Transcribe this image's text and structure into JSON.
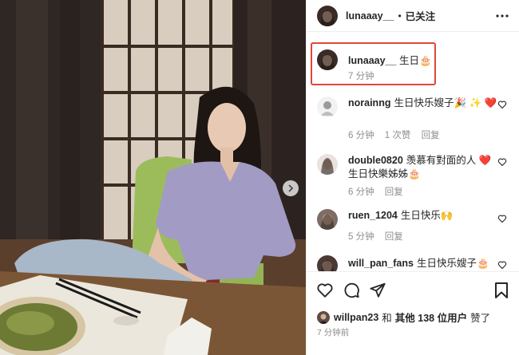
{
  "post": {
    "username": "lunaaay__",
    "separator": "•",
    "follow_status": "已关注"
  },
  "caption": {
    "username": "lunaaay__",
    "text": "生日🎂",
    "time": "7 分钟"
  },
  "comments": [
    {
      "username": "norainng",
      "text": "生日快乐嫂子🎉 ✨ ❤️",
      "time": "6 分钟",
      "likes": "1 次赞",
      "reply": "回复"
    },
    {
      "username": "double0820",
      "text": "羡慕有對面的人 ❤️ 生日快樂姊姊🎂",
      "time": "6 分钟",
      "reply": "回复"
    },
    {
      "username": "ruen_1204",
      "text": "生日快乐🙌",
      "time": "5 分钟",
      "reply": "回复"
    },
    {
      "username": "will_pan_fans",
      "text": "生日快乐嫂子🎂"
    }
  ],
  "likes": {
    "username": "willpan23",
    "connector": "和",
    "others": "其他 138 位用户",
    "suffix": "赞了"
  },
  "posted_time": "7 分钟前",
  "icons": {
    "more": "more-horizontal-icon",
    "like": "heart-outline-icon",
    "comment": "comment-bubble-icon",
    "share": "send-icon",
    "save": "bookmark-icon",
    "carousel": "chevron-right-icon"
  },
  "colors": {
    "highlight_border": "#e0463c",
    "text": "#262626",
    "muted": "#8e8e8e",
    "heart_red": "#ed4956"
  }
}
